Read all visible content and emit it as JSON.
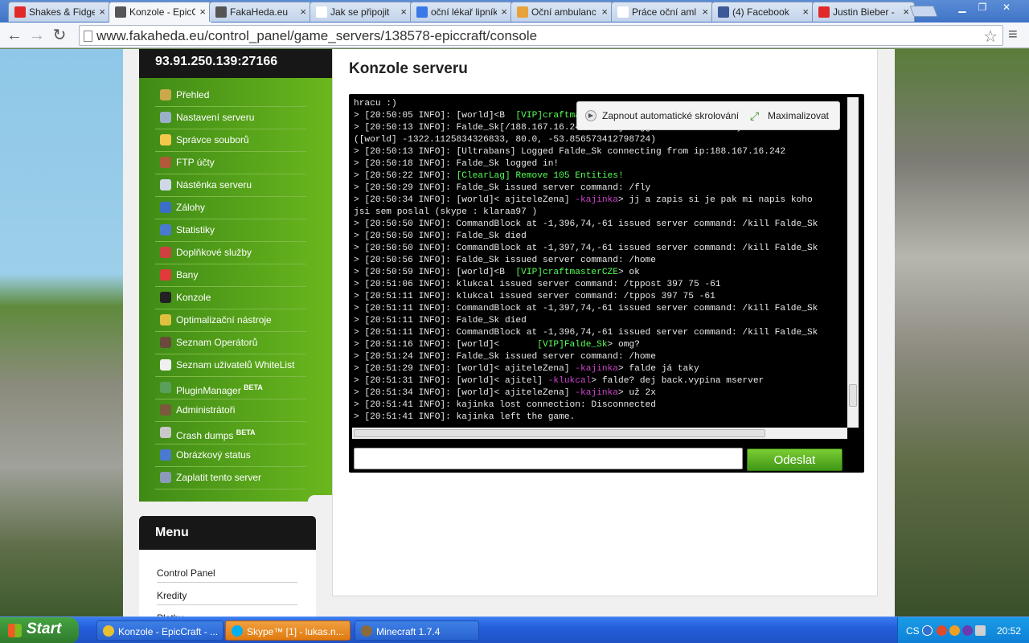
{
  "browser": {
    "tabs": [
      {
        "label": "Shakes & Fidge",
        "icon": "youtube-icon",
        "color": "#e02a2a",
        "active": false
      },
      {
        "label": "Konzole - EpicC",
        "icon": "fakaheda-icon",
        "color": "#555555",
        "active": true
      },
      {
        "label": "FakaHeda.eu",
        "icon": "fakaheda-icon",
        "color": "#555555",
        "active": false
      },
      {
        "label": "Jak se připojit",
        "icon": "page-icon",
        "color": "#ffffff",
        "active": false
      },
      {
        "label": "oční lékař lipník",
        "icon": "google-icon",
        "color": "#3b78e7",
        "active": false
      },
      {
        "label": "Oční ambulanc",
        "icon": "k-icon",
        "color": "#e8a23a",
        "active": false
      },
      {
        "label": "Práce oční aml",
        "icon": "j-icon",
        "color": "#ffffff",
        "active": false
      },
      {
        "label": "(4) Facebook",
        "icon": "facebook-icon",
        "color": "#3b5998",
        "active": false
      },
      {
        "label": "Justin Bieber -",
        "icon": "youtube-icon",
        "color": "#e02a2a",
        "active": false
      }
    ],
    "url": "www.fakaheda.eu/control_panel/game_servers/138578-epiccraft/console"
  },
  "sidebar": {
    "server_ip": "93.91.250.139:27166",
    "items": [
      {
        "label": "Přehled",
        "color": "#c9a94a"
      },
      {
        "label": "Nastavení serveru",
        "color": "#9ab0c8"
      },
      {
        "label": "Správce souborů",
        "color": "#f2c94c"
      },
      {
        "label": "FTP účty",
        "color": "#b05a3a"
      },
      {
        "label": "Nástěnka serveru",
        "color": "#d0d8e8"
      },
      {
        "label": "Zálohy",
        "color": "#3a6ec8"
      },
      {
        "label": "Statistiky",
        "color": "#4a7ad0"
      },
      {
        "label": "Doplňkové služby",
        "color": "#d04040"
      },
      {
        "label": "Bany",
        "color": "#e03a3a"
      },
      {
        "label": "Konzole",
        "color": "#222222"
      },
      {
        "label": "Optimalizační nástroje",
        "color": "#e0c040"
      },
      {
        "label": "Seznam Operátorů",
        "color": "#6a4a3a"
      },
      {
        "label": "Seznam uživatelů WhiteList",
        "color": "#f0f0f0"
      },
      {
        "label": "PluginManager",
        "badge": "BETA",
        "color": "#5aa05a"
      },
      {
        "label": "Administrátoři",
        "color": "#7a5a3a"
      },
      {
        "label": "Crash dumps",
        "badge": "BETA",
        "color": "#c8c8c8"
      },
      {
        "label": "Obrázkový status",
        "color": "#4a7ad0"
      },
      {
        "label": "Zaplatit tento server",
        "color": "#8a9ab8"
      }
    ]
  },
  "menu": {
    "title": "Menu",
    "links": [
      "Control Panel",
      "Kredity",
      "Platby"
    ]
  },
  "main": {
    "title": "Konzole serveru",
    "console_options": {
      "autoscroll_label": "Zapnout automatické skrolování",
      "maximize_label": "Maximalizovat"
    },
    "log": [
      [
        [
          "hracu :)",
          ""
        ]
      ],
      [
        [
          "> [20:50:05 INFO]: [world]<B  ",
          ""
        ],
        [
          "[VIP]craftmasterCZE",
          "g"
        ],
        [
          "> ",
          ""
        ]
      ],
      [
        [
          "> [20:50:13 INFO]: Falde_Sk[/188.167.16.242:54852] logged in with entity id 4256299 at",
          ""
        ]
      ],
      [
        [
          "([world] -1322.1125834326833, 80.0, -53.856573412798724)",
          ""
        ]
      ],
      [
        [
          "> [20:50:13 INFO]: [Ultrabans] Logged Falde_Sk connecting from ip:188.167.16.242",
          ""
        ]
      ],
      [
        [
          "> [20:50:18 INFO]: Falde_Sk logged in!",
          ""
        ]
      ],
      [
        [
          "> [20:50:22 INFO]: ",
          ""
        ],
        [
          "[ClearLag] Remove 105 Entities!",
          "g"
        ]
      ],
      [
        [
          "> [20:50:29 INFO]: Falde_Sk issued server command: /fly",
          ""
        ]
      ],
      [
        [
          "> [20:50:34 INFO]: [world]< ajiteleZena] ",
          ""
        ],
        [
          "-kajinka",
          "p"
        ],
        [
          "> jj a zapis si je pak mi napis koho",
          ""
        ]
      ],
      [
        [
          "jsi sem poslal (skype : klaraa97 )",
          ""
        ]
      ],
      [
        [
          "> [20:50:50 INFO]: CommandBlock at -1,396,74,-61 issued server command: /kill Falde_Sk",
          ""
        ]
      ],
      [
        [
          "> [20:50:50 INFO]: Falde_Sk died",
          ""
        ]
      ],
      [
        [
          "> [20:50:50 INFO]: CommandBlock at -1,397,74,-61 issued server command: /kill Falde_Sk",
          ""
        ]
      ],
      [
        [
          "> [20:50:56 INFO]: Falde_Sk issued server command: /home",
          ""
        ]
      ],
      [
        [
          "> [20:50:59 INFO]: [world]<B  ",
          ""
        ],
        [
          "[VIP]craftmasterCZE",
          "g"
        ],
        [
          "> ok",
          ""
        ]
      ],
      [
        [
          "> [20:51:06 INFO]: klukcal issued server command: /tppost 397 75 -61",
          ""
        ]
      ],
      [
        [
          "> [20:51:11 INFO]: klukcal issued server command: /tppos 397 75 -61",
          ""
        ]
      ],
      [
        [
          "> [20:51:11 INFO]: CommandBlock at -1,397,74,-61 issued server command: /kill Falde_Sk",
          ""
        ]
      ],
      [
        [
          "> [20:51:11 INFO]: Falde_Sk died",
          ""
        ]
      ],
      [
        [
          "> [20:51:11 INFO]: CommandBlock at -1,396,74,-61 issued server command: /kill Falde_Sk",
          ""
        ]
      ],
      [
        [
          "> [20:51:16 INFO]: [world]<       ",
          ""
        ],
        [
          "[VIP]Falde_Sk",
          "g"
        ],
        [
          "> omg?",
          ""
        ]
      ],
      [
        [
          "> [20:51:24 INFO]: Falde_Sk issued server command: /home",
          ""
        ]
      ],
      [
        [
          "> [20:51:29 INFO]: [world]< ajiteleZena] ",
          ""
        ],
        [
          "-kajinka",
          "p"
        ],
        [
          "> falde já taky",
          ""
        ]
      ],
      [
        [
          "> [20:51:31 INFO]: [world]< ajitel] ",
          ""
        ],
        [
          "-klukcal",
          "p"
        ],
        [
          "> falde? dej back.vypina mserver",
          ""
        ]
      ],
      [
        [
          "> [20:51:34 INFO]: [world]< ajiteleZena] ",
          ""
        ],
        [
          "-kajinka",
          "p"
        ],
        [
          "> už 2x",
          ""
        ]
      ],
      [
        [
          "> [20:51:41 INFO]: kajinka lost connection: Disconnected",
          ""
        ]
      ],
      [
        [
          "> [20:51:41 INFO]: kajinka left the game.",
          ""
        ]
      ]
    ],
    "input_value": "",
    "send_label": "Odeslat"
  },
  "taskbar": {
    "start_label": "Start",
    "tasks": [
      {
        "label": "Konzole - EpicCraft - ...",
        "icon": "chrome-icon",
        "color": "#e8c030"
      },
      {
        "label": "Skype™ [1] - lukas.n...",
        "icon": "skype-icon",
        "color": "#00aff0"
      },
      {
        "label": "Minecraft 1.7.4",
        "icon": "minecraft-icon",
        "color": "#8b6b3a"
      }
    ],
    "language": "CS",
    "clock": "20:52"
  }
}
